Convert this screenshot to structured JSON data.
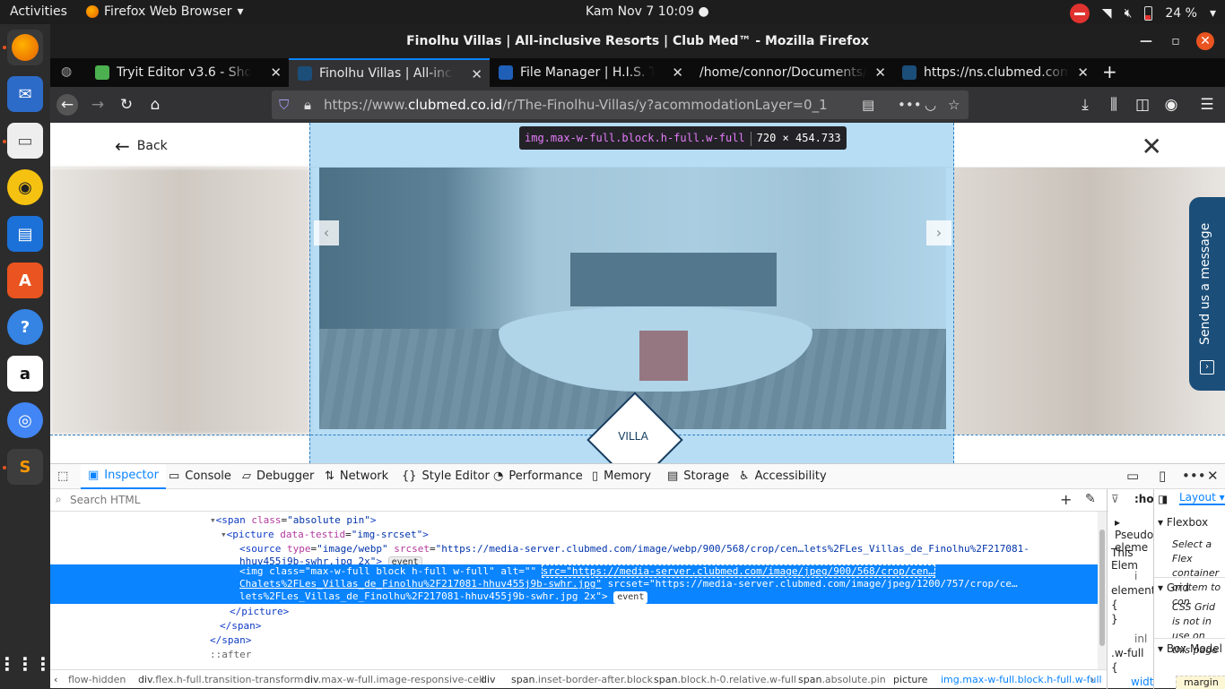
{
  "topbar": {
    "activities": "Activities",
    "app_menu": "Firefox Web Browser",
    "clock": "Kam Nov 7  10:09",
    "battery": "24 %"
  },
  "dock": {
    "items": [
      "firefox",
      "thunderbird",
      "files",
      "rhythmbox",
      "libreoffice-writer",
      "software-center",
      "help",
      "amazon",
      "chromium",
      "sublime-text",
      "show-apps"
    ]
  },
  "window": {
    "title": "Finolhu Villas | All-inclusive Resorts | Club Med™ - Mozilla Firefox"
  },
  "tabs": [
    {
      "label": "Tryit Editor v3.6 - Show S",
      "color": "#4caf50"
    },
    {
      "label": "Finolhu Villas | All-inclusi",
      "color": "#1b4e79"
    },
    {
      "label": "File Manager | H.I.S. Trav",
      "color": "#1f5fb8"
    },
    {
      "label": "/home/connor/Documents/",
      "color": ""
    },
    {
      "label": "https://ns.clubmed.com",
      "color": "#1b4e79"
    }
  ],
  "urlbar": {
    "prefix": "https://www.",
    "host": "clubmed.co.id",
    "path": "/r/The-Finolhu-Villas/y?acommodationLayer=0_1"
  },
  "page": {
    "back_label": "Back",
    "villa_label": "VILLA",
    "send_message": "Send us a message",
    "tooltip_selector": "img.max-w-full.block.h-full.w-full",
    "tooltip_size": "720 × 454.733"
  },
  "devtools": {
    "tabs": [
      "Inspector",
      "Console",
      "Debugger",
      "Network",
      "Style Editor",
      "Performance",
      "Memory",
      "Storage",
      "Accessibility"
    ],
    "search_placeholder": "Search HTML",
    "markup": {
      "l1_tag_open": "<span ",
      "l1_attr": "class",
      "l1_val": "\"absolute pin\"",
      "l1_close": ">",
      "l2_tag_open": "<picture ",
      "l2_attr": "data-testid",
      "l2_val": "\"img-srcset\"",
      "l2_close": ">",
      "l3_tag_open": "<source ",
      "l3_attr1": "type",
      "l3_val1": "\"image/webp\"",
      "l3_attr2": "srcset",
      "l3_val2": "\"https://media-server.clubmed.com/image/webp/900/568/crop/cen…lets%2FLes_Villas_de_Finolhu%2F217081-",
      "l3b": "hhuv455j9b-swhr.jpg 2x\"",
      "l3_close": ">",
      "event": "event",
      "sel1": "<img class=\"max-w-full block h-full w-full\" alt=\"\" ",
      "sel1_src": "src=\"https://media-server.clubmed.com/image/jpeg/900/568/crop/cen…",
      "sel2": "Chalets%2FLes_Villas_de_Finolhu%2F217081-hhuv455j9b-swhr.jpg\"",
      "sel2b": " srcset=\"https://media-server.clubmed.com/image/jpeg/1200/757/crop/ce…",
      "sel3": "lets%2FLes_Villas_de_Finolhu%2F217081-hhuv455j9b-swhr.jpg 2x\">",
      "l7": "</picture>",
      "l8": "</span>",
      "l9": "</span>",
      "l10": "::after"
    },
    "breadcrumbs": [
      {
        "tag": "",
        "cls": "flow-hidden"
      },
      {
        "tag": "div",
        "cls": ".flex.h-full.transition-transform"
      },
      {
        "tag": "div",
        "cls": ".max-w-full.image-responsive-cell"
      },
      {
        "tag": "div",
        "cls": ""
      },
      {
        "tag": "span",
        "cls": ".inset-border-after.block"
      },
      {
        "tag": "span",
        "cls": ".block.h-0.relative.w-full"
      },
      {
        "tag": "span",
        "cls": ".absolute.pin"
      },
      {
        "tag": "picture",
        "cls": ""
      },
      {
        "tag": "img",
        "cls": ".max-w-full.block.h-full.w-full"
      }
    ],
    "rules": {
      "hov": ":ho",
      "pseudo": "Pseudo-eleme",
      "this_element": "This Elem",
      "rule_i": "i",
      "element": "element",
      "brace_open": "{",
      "brace_close": "}",
      "inline": "inl",
      "wfull": ".w-full",
      "width": "widt",
      "ten": "10"
    },
    "layout": {
      "tab": "Layout",
      "flexbox": "Flexbox",
      "flex_hint": "Select a Flex container or item to con",
      "grid": "Grid",
      "grid_hint": "CSS Grid is not in use on this page",
      "box_model": "Box Model",
      "margin": "margin"
    }
  }
}
